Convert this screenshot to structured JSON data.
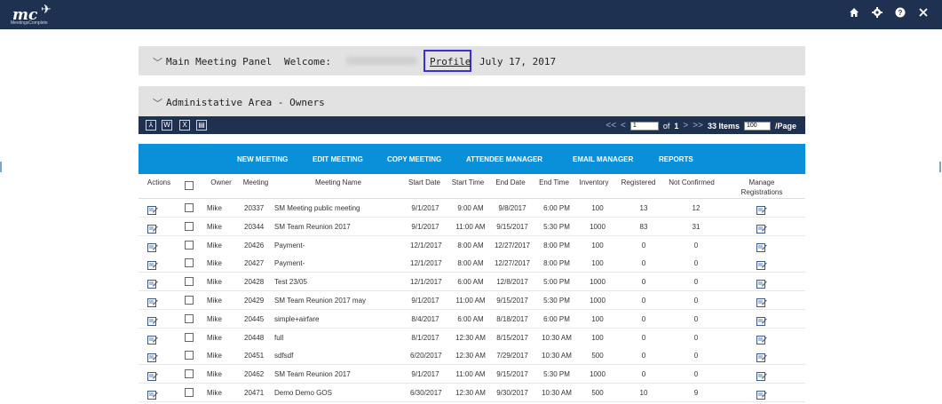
{
  "app": {
    "logo_text": "mc",
    "logo_sub": "MeetingsComplete"
  },
  "header_icons": [
    "home-icon",
    "gear-icon",
    "help-icon",
    "close-icon"
  ],
  "main_panel": {
    "title": "Main Meeting Panel",
    "welcome": "Welcome:",
    "profile": "Profile",
    "date": "July 17, 2017"
  },
  "admin_panel": {
    "title": "Administative Area - Owners"
  },
  "export_icons": [
    "pdf-icon",
    "word-icon",
    "excel-icon",
    "print-icon"
  ],
  "pager": {
    "first": "<<",
    "prev": "<",
    "page": "1",
    "of_label": "of",
    "total_pages": "1",
    "next": ">",
    "last": ">>",
    "items": "33 Items",
    "per_page": "100",
    "per_page_label": "/Page"
  },
  "actions": [
    "NEW MEETING",
    "EDIT MEETING",
    "COPY MEETING",
    "ATTENDEE MANAGER",
    "EMAIL MANAGER",
    "REPORTS"
  ],
  "columns": [
    "Actions",
    "",
    "Owner",
    "Meeting",
    "Meeting Name",
    "Start Date",
    "Start Time",
    "End Date",
    "End Time",
    "Inventory",
    "Registered",
    "Not Confirmed",
    "Manage Registrations"
  ],
  "rows": [
    [
      "Mike",
      "20337",
      "SM Meeting public meeting",
      "9/1/2017",
      "9:00 AM",
      "9/8/2017",
      "6:00 PM",
      "100",
      "13",
      "12"
    ],
    [
      "Mike",
      "20344",
      "SM Team Reunion 2017",
      "9/1/2017",
      "11:00 AM",
      "9/15/2017",
      "5:30 PM",
      "1000",
      "83",
      "31"
    ],
    [
      "Mike",
      "20426",
      "Payment-",
      "12/1/2017",
      "8:00 AM",
      "12/27/2017",
      "8:00 PM",
      "100",
      "0",
      "0"
    ],
    [
      "Mike",
      "20427",
      "Payment-",
      "12/1/2017",
      "8:00 AM",
      "12/27/2017",
      "8:00 PM",
      "100",
      "0",
      "0"
    ],
    [
      "Mike",
      "20428",
      "Test 23/05",
      "12/1/2017",
      "6:00 AM",
      "12/8/2017",
      "5:00 PM",
      "1000",
      "0",
      "0"
    ],
    [
      "Mike",
      "20429",
      "SM Team Reunion 2017 may",
      "9/1/2017",
      "11:00 AM",
      "9/15/2017",
      "5:30 PM",
      "1000",
      "0",
      "0"
    ],
    [
      "Mike",
      "20445",
      "simple+airfare",
      "8/4/2017",
      "6:00 AM",
      "8/18/2017",
      "6:00 PM",
      "100",
      "0",
      "0"
    ],
    [
      "Mike",
      "20448",
      "full",
      "8/1/2017",
      "12:30 AM",
      "8/15/2017",
      "10:30 AM",
      "100",
      "0",
      "0"
    ],
    [
      "Mike",
      "20451",
      "sdfsdf",
      "6/20/2017",
      "12:30 AM",
      "7/29/2017",
      "10:30 AM",
      "500",
      "0",
      "0"
    ],
    [
      "Mike",
      "20462",
      "SM Team Reunion 2017",
      "9/1/2017",
      "11:00 AM",
      "9/15/2017",
      "5:30 PM",
      "1000",
      "0",
      "0"
    ],
    [
      "Mike",
      "20471",
      "Demo Demo GOS",
      "6/30/2017",
      "12:30 AM",
      "9/30/2017",
      "10:30 AM",
      "500",
      "10",
      "9"
    ]
  ],
  "colors": {
    "header": "#1f3150",
    "actionbar": "#0a8fd9",
    "panel": "#e2e2e2",
    "highlight": "#3a2ed6"
  }
}
